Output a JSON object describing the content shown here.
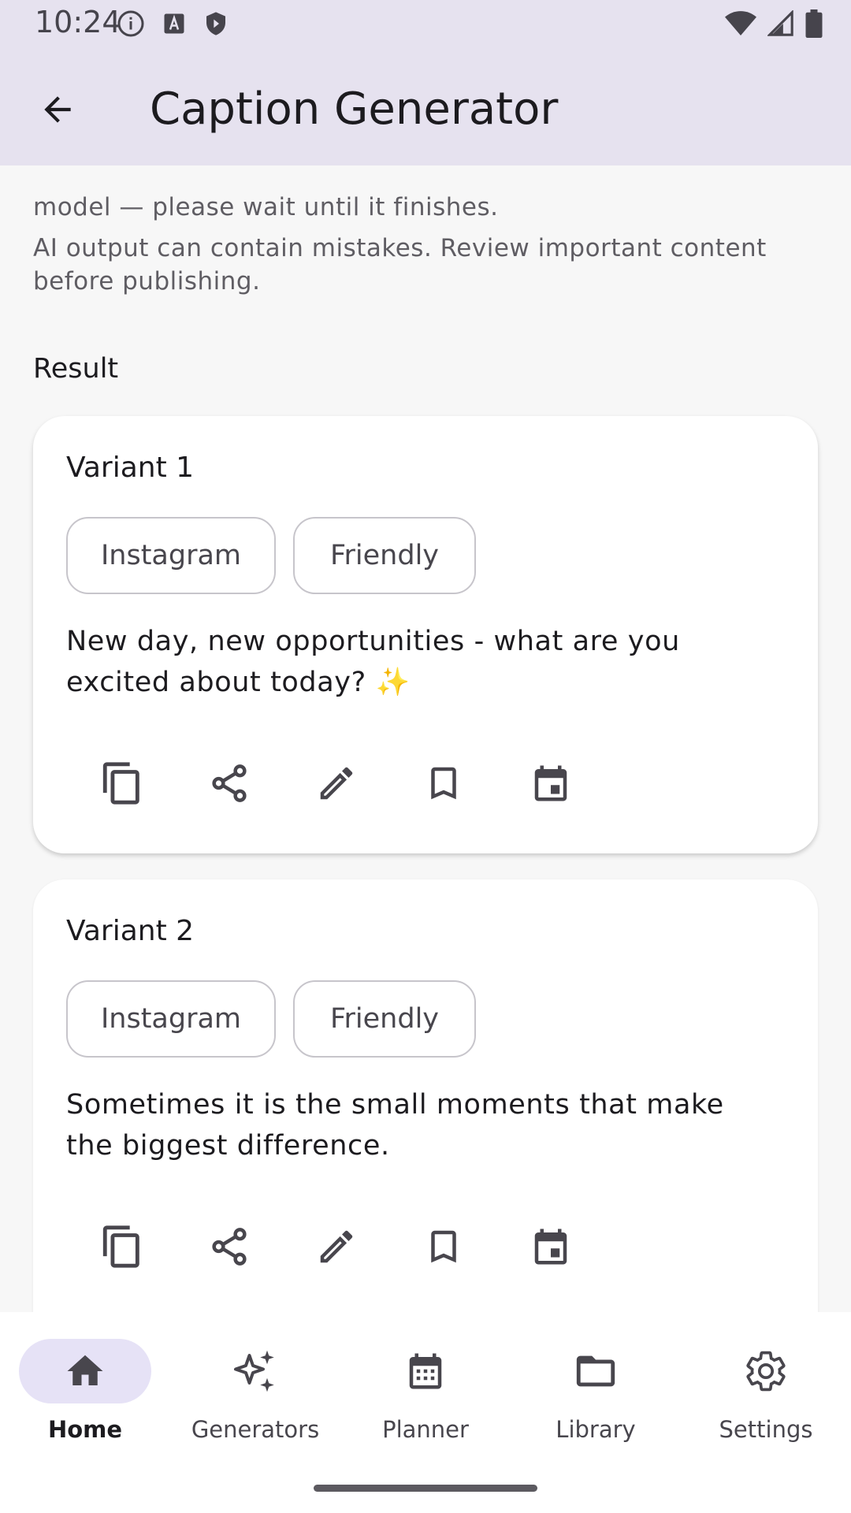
{
  "status_bar": {
    "time": "10:24",
    "left_icons": [
      "info-icon",
      "keyboard-a-icon",
      "shield-icon"
    ],
    "right_icons": [
      "wifi-icon",
      "cell-signal-icon",
      "battery-icon"
    ]
  },
  "app_bar": {
    "back_icon": "arrow-back-icon",
    "title": "Caption Generator"
  },
  "notes": {
    "progress_tail": "model — please wait until it finishes.",
    "disclaimer": "AI output can contain mistakes. Review important content before publishing."
  },
  "result": {
    "heading": "Result",
    "variants": [
      {
        "title": "Variant 1",
        "chips": [
          "Instagram",
          "Friendly"
        ],
        "caption": "New day, new opportunities - what are you excited about today? ✨",
        "actions": [
          "copy-icon",
          "share-icon",
          "edit-icon",
          "bookmark-icon",
          "calendar-icon"
        ]
      },
      {
        "title": "Variant 2",
        "chips": [
          "Instagram",
          "Friendly"
        ],
        "caption": "Sometimes it is the small moments that make the biggest difference.",
        "actions": [
          "copy-icon",
          "share-icon",
          "edit-icon",
          "bookmark-icon",
          "calendar-icon"
        ]
      }
    ]
  },
  "bottom_nav": {
    "items": [
      {
        "label": "Home",
        "icon": "home-icon",
        "active": true
      },
      {
        "label": "Generators",
        "icon": "sparkles-icon",
        "active": false
      },
      {
        "label": "Planner",
        "icon": "calendar-icon",
        "active": false
      },
      {
        "label": "Library",
        "icon": "folder-icon",
        "active": false
      },
      {
        "label": "Settings",
        "icon": "gear-icon",
        "active": false
      }
    ]
  },
  "colors": {
    "app_bar_bg": "#e6e2ef",
    "active_nav_pill": "#e6e2f6",
    "icon": "#48464d",
    "sparkle": "#f5c518"
  }
}
